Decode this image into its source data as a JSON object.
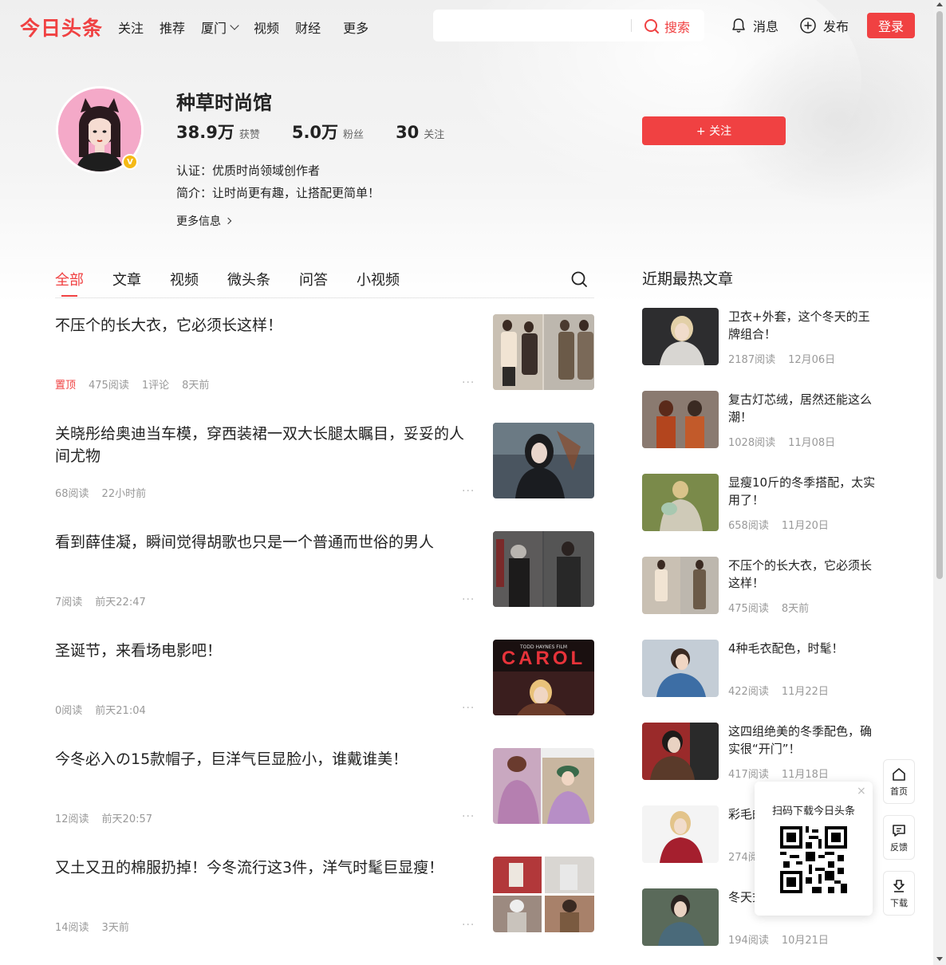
{
  "header": {
    "logo": "今日头条",
    "nav": [
      "关注",
      "推荐",
      "厦门",
      "视频",
      "财经",
      "更多"
    ],
    "search_placeholder": "",
    "search_label": "搜索",
    "messages_label": "消息",
    "publish_label": "发布",
    "login_label": "登录"
  },
  "profile": {
    "name": "种草时尚馆",
    "stats": [
      {
        "value": "38.9万",
        "label": "获赞"
      },
      {
        "value": "5.0万",
        "label": "粉丝"
      },
      {
        "value": "30",
        "label": "关注"
      }
    ],
    "certification": "认证：优质时尚领域创作者",
    "intro": "简介：让时尚更有趣，让搭配更简单！",
    "more_info": "更多信息",
    "follow_label": "+ 关注",
    "verified_badge": "V"
  },
  "tabs": [
    "全部",
    "文章",
    "视频",
    "微头条",
    "问答",
    "小视频"
  ],
  "feed": [
    {
      "title": "不压个的长大衣，它必须长这样！",
      "pinned": "置顶",
      "reads": "475阅读",
      "comments": "1评论",
      "time": "8天前"
    },
    {
      "title": "关晓彤给奥迪当车模，穿西装裙一双大长腿太瞩目，妥妥的人间尤物",
      "reads": "68阅读",
      "time": "22小时前"
    },
    {
      "title": "看到薛佳凝，瞬间觉得胡歌也只是一个普通而世俗的男人",
      "reads": "7阅读",
      "time": "前天22:47"
    },
    {
      "title": "圣诞节，来看场电影吧！",
      "reads": "0阅读",
      "time": "前天21:04",
      "thumb_text": "CAROL",
      "thumb_small": "TODD HAYNES FILM"
    },
    {
      "title": "今冬必入の15款帽子，巨洋气巨显脸小，谁戴谁美！",
      "reads": "12阅读",
      "time": "前天20:57"
    },
    {
      "title": "又土又丑的棉服扔掉！今冬流行这3件，洋气时髦巨显瘦！",
      "reads": "14阅读",
      "time": "3天前"
    }
  ],
  "feed_dots": "···",
  "hot": {
    "title": "近期最热文章",
    "items": [
      {
        "title": "卫衣+外套，这个冬天的王牌组合！",
        "reads": "2187阅读",
        "date": "12月06日"
      },
      {
        "title": "复古灯芯绒，居然还能这么潮！",
        "reads": "1028阅读",
        "date": "11月08日"
      },
      {
        "title": "显瘦10斤的冬季搭配，太实用了！",
        "reads": "658阅读",
        "date": "11月20日"
      },
      {
        "title": "不压个的长大衣，它必须长这样！",
        "reads": "475阅读",
        "date": "8天前"
      },
      {
        "title": "4种毛衣配色，时髦！",
        "reads": "422阅读",
        "date": "11月22日"
      },
      {
        "title": "这四组绝美的冬季配色，确实很“开门”！",
        "reads": "417阅读",
        "date": "11月18日"
      },
      {
        "title": "彩毛的！",
        "reads": "274阅",
        "date": ""
      },
      {
        "title": "冬天式很高级！",
        "reads": "194阅读",
        "date": "10月21日"
      }
    ]
  },
  "qr": {
    "close": "×",
    "label": "扫码下载今日头条"
  },
  "side": {
    "home": "首页",
    "feedback": "反馈",
    "download": "下载"
  },
  "colors": {
    "accent": "#f04142",
    "text": "#222222",
    "meta": "#999999"
  }
}
